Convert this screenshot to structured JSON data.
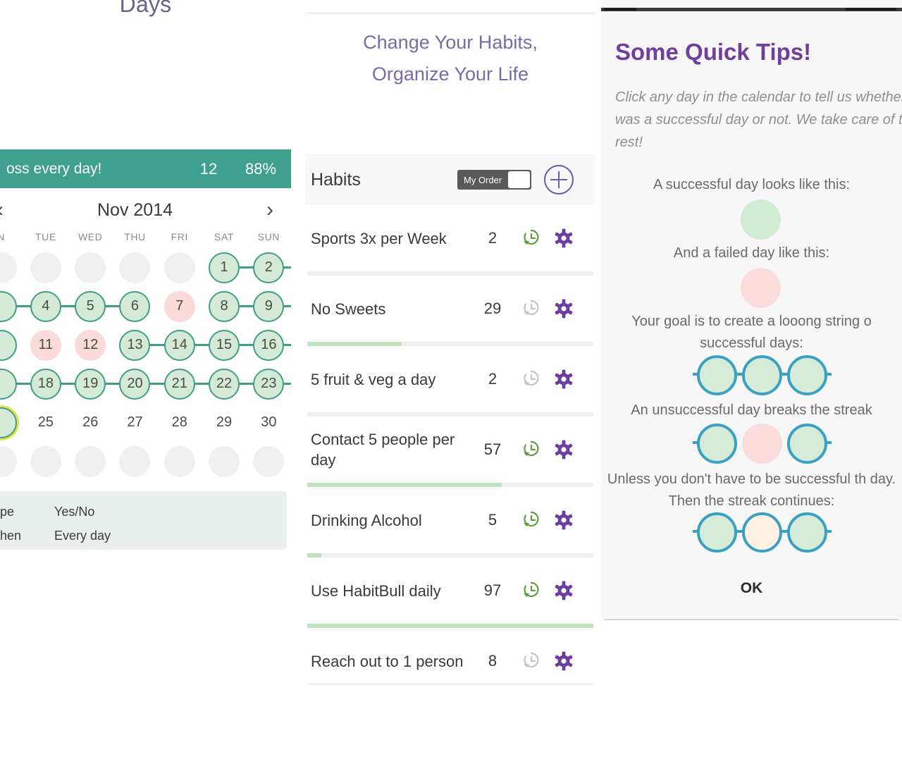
{
  "calendar_panel": {
    "title": "Days",
    "streak": {
      "text": "oss every day!",
      "count": "12",
      "percent": "88%",
      "color": "#3fa08d"
    },
    "nav": {
      "prev_icon": "chevron-left-icon",
      "next_icon": "chevron-right-icon",
      "month": "Nov 2014"
    },
    "weekdays": [
      "N",
      "TUE",
      "WED",
      "THU",
      "FRI",
      "SAT",
      "SUN"
    ],
    "weeks": [
      [
        {
          "label": "",
          "state": "empty"
        },
        {
          "label": "",
          "state": "empty"
        },
        {
          "label": "",
          "state": "empty"
        },
        {
          "label": "",
          "state": "empty"
        },
        {
          "label": "",
          "state": "empty"
        },
        {
          "label": "1",
          "state": "ok",
          "link": true
        },
        {
          "label": "2",
          "state": "ok",
          "link": true
        }
      ],
      [
        {
          "label": "",
          "state": "ok",
          "link": true
        },
        {
          "label": "4",
          "state": "ok",
          "link": true
        },
        {
          "label": "5",
          "state": "ok",
          "link": true
        },
        {
          "label": "6",
          "state": "ok"
        },
        {
          "label": "7",
          "state": "fail"
        },
        {
          "label": "8",
          "state": "ok",
          "link": true
        },
        {
          "label": "9",
          "state": "ok",
          "link": true
        }
      ],
      [
        {
          "label": "",
          "state": "ok"
        },
        {
          "label": "11",
          "state": "fail"
        },
        {
          "label": "12",
          "state": "fail"
        },
        {
          "label": "13",
          "state": "ok",
          "link": true
        },
        {
          "label": "14",
          "state": "ok",
          "link": true
        },
        {
          "label": "15",
          "state": "ok",
          "link": true
        },
        {
          "label": "16",
          "state": "ok",
          "link": true
        }
      ],
      [
        {
          "label": "",
          "state": "ok",
          "link": true
        },
        {
          "label": "18",
          "state": "ok",
          "link": true
        },
        {
          "label": "19",
          "state": "ok",
          "link": true
        },
        {
          "label": "20",
          "state": "ok",
          "link": true
        },
        {
          "label": "21",
          "state": "ok",
          "link": true
        },
        {
          "label": "22",
          "state": "ok",
          "link": true
        },
        {
          "label": "23",
          "state": "ok",
          "link": true
        }
      ],
      [
        {
          "label": "",
          "state": "today"
        },
        {
          "label": "25",
          "state": "plain"
        },
        {
          "label": "26",
          "state": "plain"
        },
        {
          "label": "27",
          "state": "plain"
        },
        {
          "label": "28",
          "state": "plain"
        },
        {
          "label": "29",
          "state": "plain"
        },
        {
          "label": "30",
          "state": "plain"
        }
      ],
      [
        {
          "label": "",
          "state": "empty"
        },
        {
          "label": "",
          "state": "empty"
        },
        {
          "label": "",
          "state": "empty"
        },
        {
          "label": "",
          "state": "empty"
        },
        {
          "label": "",
          "state": "empty"
        },
        {
          "label": "",
          "state": "empty"
        },
        {
          "label": "",
          "state": "empty"
        }
      ]
    ],
    "info": [
      {
        "key": "pe",
        "value": "Yes/No"
      },
      {
        "key": "hen",
        "value": "Every day"
      }
    ]
  },
  "habits_panel": {
    "tagline_line1": "Change Your Habits,",
    "tagline_line2": "Organize Your Life",
    "list_title": "Habits",
    "order_toggle_label": "My Order",
    "add_icon": "plus-circle-icon",
    "history_icon": "history-clock-icon",
    "settings_icon": "gear-icon",
    "habits": [
      {
        "name": "Sports 3x per Week",
        "count": "2",
        "progress": 0,
        "history_active": true
      },
      {
        "name": "No Sweets",
        "count": "29",
        "progress": 33,
        "history_active": false
      },
      {
        "name": "5 fruit & veg a day",
        "count": "2",
        "progress": 0,
        "history_active": false
      },
      {
        "name": "Contact 5 people per day",
        "count": "57",
        "progress": 68,
        "history_active": true
      },
      {
        "name": "Drinking Alcohol",
        "count": "5",
        "progress": 5,
        "history_active": true
      },
      {
        "name": "Use HabitBull daily",
        "count": "97",
        "progress": 100,
        "history_active": true
      },
      {
        "name": "Reach out to 1 person",
        "count": "8",
        "progress": 0,
        "history_active": false
      }
    ]
  },
  "tips_panel": {
    "title": "Some Quick Tips!",
    "intro": "Click any day in the calendar to tell us whether it was a successful day or not. We take care of the rest!",
    "line_success": "A successful day looks like this:",
    "line_fail": "And a failed day like this:",
    "line_goal": "Your goal is to create a looong string o successful days:",
    "line_break": "An unsuccessful day breaks the streak",
    "line_unless": "Unless you don't have to be successful th day. Then the streak continues:",
    "ok_label": "OK",
    "colors": {
      "success_fill": "#d0ecd2",
      "fail_fill": "#fbdcdc",
      "skip_fill": "#fdf2e2",
      "ring_stroke": "#3aa0c4",
      "title": "#6f3f9e"
    }
  }
}
